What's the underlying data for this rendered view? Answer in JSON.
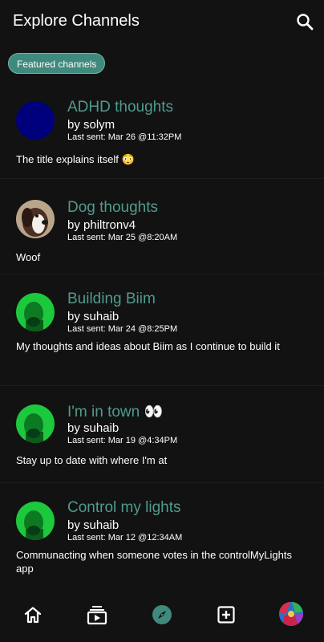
{
  "header": {
    "title": "Explore Channels",
    "search_icon": "search-icon"
  },
  "filter": {
    "chip_label": "Featured channels"
  },
  "channels": [
    {
      "name": "ADHD thoughts",
      "by": "by solym",
      "last_sent": "Last sent: Mar 26 @11:32PM",
      "description": "The title explains itself 😳"
    },
    {
      "name": "Dog thoughts",
      "by": "by philtronv4",
      "last_sent": "Last sent: Mar 25 @8:20AM",
      "description": "Woof"
    },
    {
      "name": "Building Biim",
      "by": "by suhaib",
      "last_sent": "Last sent: Mar 24 @8:25PM",
      "description": "My thoughts and ideas about Biim as I continue to build it"
    },
    {
      "name": "I'm in town 👀",
      "by": "by suhaib",
      "last_sent": "Last sent: Mar 19 @4:34PM",
      "description": "Stay up to date with where I'm at"
    },
    {
      "name": "Control my lights",
      "by": "by suhaib",
      "last_sent": "Last sent: Mar 12 @12:34AM",
      "description": "Communacting when someone votes in the controlMyLights app"
    }
  ],
  "bottom_nav": {
    "icons": [
      "home-icon",
      "feed-icon",
      "explore-icon",
      "add-icon",
      "profile-avatar"
    ],
    "active": "explore-icon",
    "accent": "#3f8a7d"
  }
}
